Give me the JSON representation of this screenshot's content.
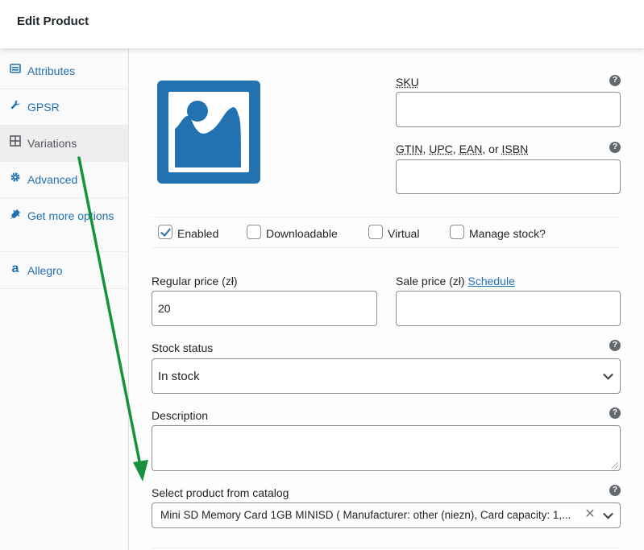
{
  "header": {
    "title": "Edit Product"
  },
  "sidebar": {
    "items": [
      {
        "label": "Attributes",
        "icon": "list-icon"
      },
      {
        "label": "GPSR",
        "icon": "wrench-icon"
      },
      {
        "label": "Variations",
        "icon": "grid-icon",
        "active": true
      },
      {
        "label": "Advanced",
        "icon": "gear-icon"
      },
      {
        "label": "Get more options",
        "icon": "plug-icon"
      },
      {
        "label": "Allegro",
        "icon": "allegro-icon"
      }
    ]
  },
  "variation": {
    "sku_label": "SKU",
    "sku_value": "",
    "gtin_label_parts": [
      "GTIN",
      ", ",
      "UPC",
      ", ",
      "EAN",
      ", or ",
      "ISBN"
    ],
    "gtin_value": "",
    "help_glyph": "?",
    "checkboxes": [
      {
        "label": "Enabled",
        "checked": true
      },
      {
        "label": "Downloadable",
        "checked": false
      },
      {
        "label": "Virtual",
        "checked": false
      },
      {
        "label": "Manage stock?",
        "checked": false
      }
    ],
    "regular_price_label": "Regular price (zł)",
    "regular_price_value": "20",
    "sale_price_label": "Sale price (zł)",
    "sale_price_link": "Schedule",
    "sale_price_value": "",
    "stock_status_label": "Stock status",
    "stock_status_value": "In stock",
    "description_label": "Description",
    "catalog_label": "Select product from catalog",
    "catalog_value": "Mini SD Memory Card 1GB MINISD ( Manufacturer: other (niezn), Card capacity: 1,...",
    "clear_glyph": "✕"
  },
  "colors": {
    "accent": "#2271b1",
    "annotation_arrow": "#17923b"
  }
}
